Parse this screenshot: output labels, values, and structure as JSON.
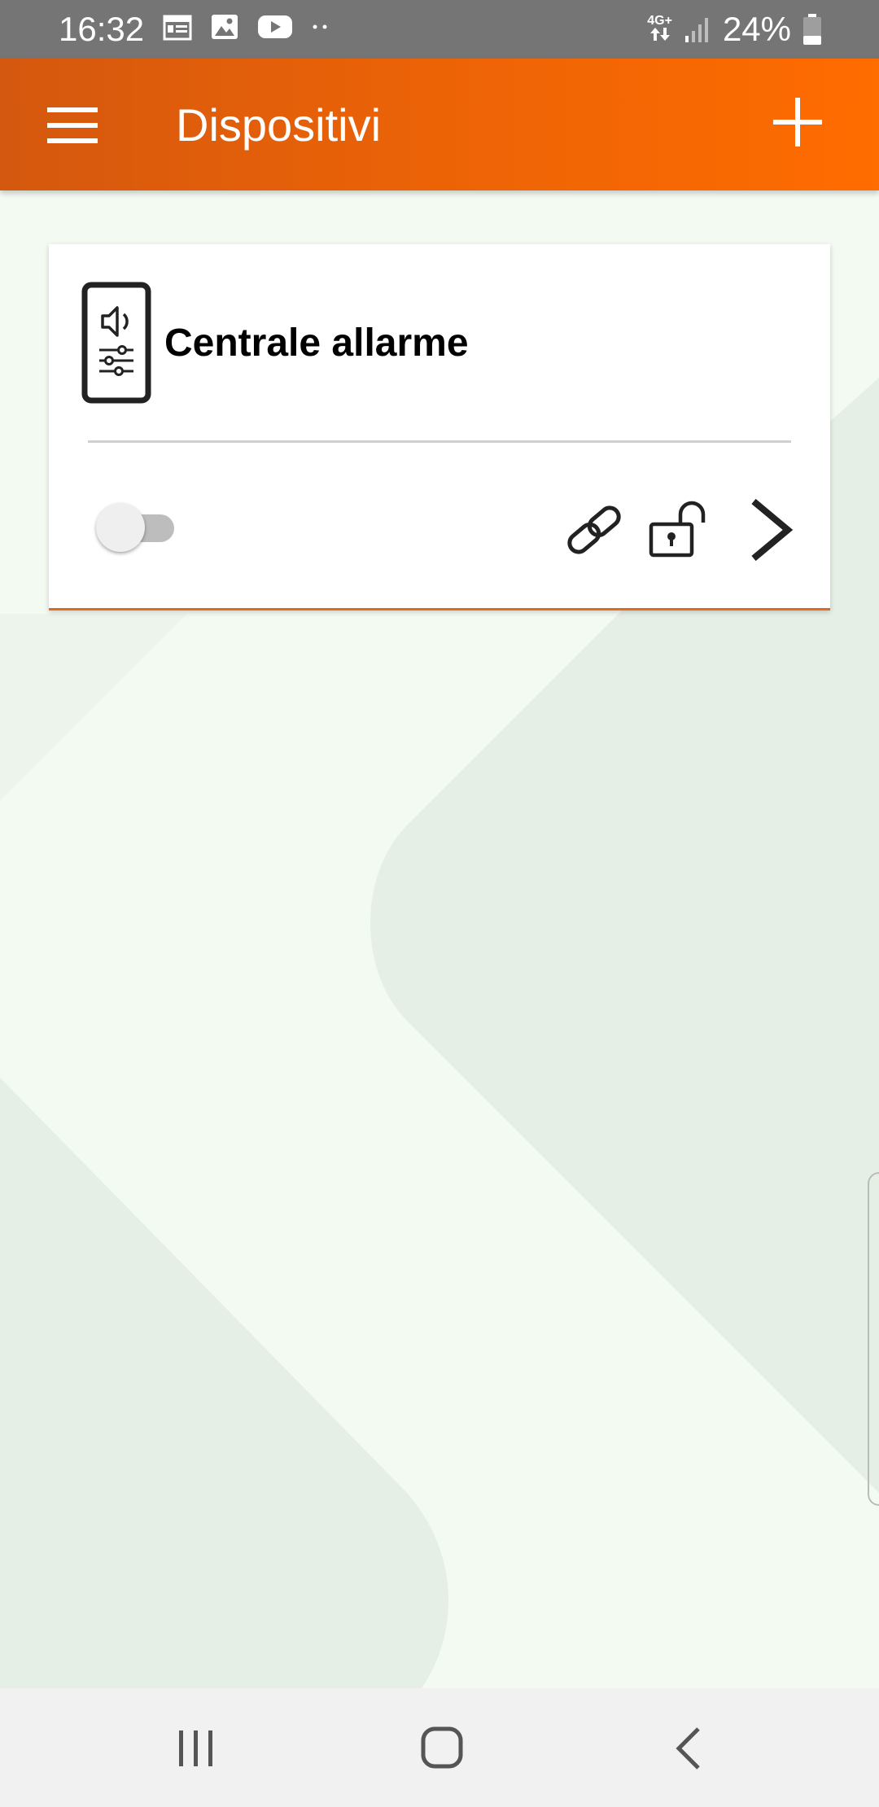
{
  "status_bar": {
    "time": "16:32",
    "network": "4G+",
    "battery": "24%",
    "notification_icons": [
      "calendar-icon",
      "image-icon",
      "youtube-icon",
      "more-dots-icon"
    ]
  },
  "app_bar": {
    "title": "Dispositivi",
    "menu_icon": "hamburger-menu-icon",
    "add_icon": "plus-icon"
  },
  "devices": [
    {
      "name": "Centrale allarme",
      "icon": "alarm-panel-icon",
      "toggle_on": false,
      "actions": [
        "link-icon",
        "unlocked-lock-icon",
        "chevron-right-icon"
      ]
    }
  ],
  "colors": {
    "appbar_start": "#d4580f",
    "appbar_end": "#ff6c00",
    "card_accent": "#e26a1e",
    "background": "#f3faf2",
    "background_shape": "#e6efe6"
  },
  "nav_bar": {
    "icons": [
      "recents-icon",
      "home-icon",
      "back-icon"
    ]
  }
}
